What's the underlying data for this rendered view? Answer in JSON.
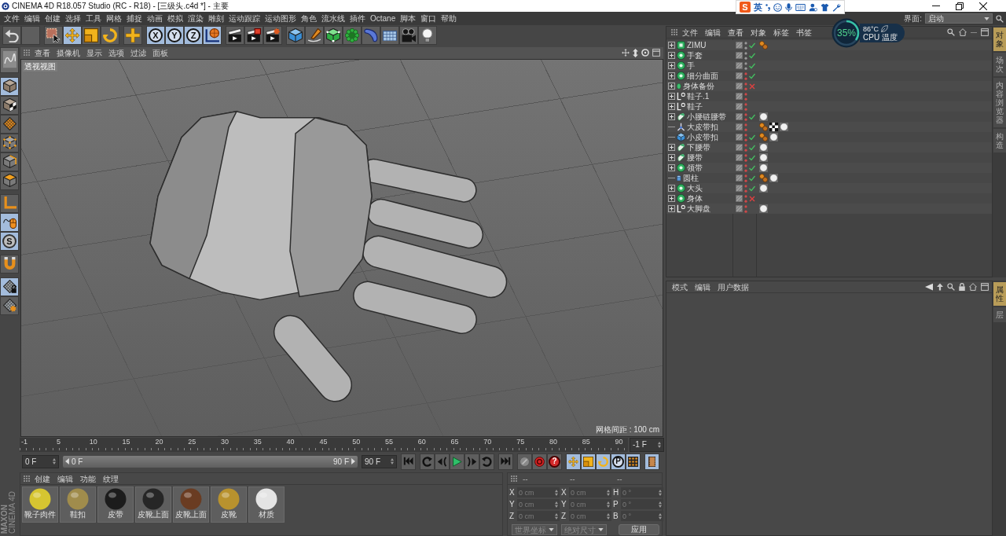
{
  "window": {
    "title": "CINEMA 4D R18.057 Studio (RC - R18) - [三级头.c4d *] - 主要"
  },
  "ime_bar": {
    "logo": "S",
    "mode": "英"
  },
  "cpu_widget": {
    "usage": "35%",
    "level": 0.35,
    "temperature": "86°C",
    "label": "CPU 温度"
  },
  "menu_bar": {
    "items": [
      "文件",
      "编辑",
      "创建",
      "选择",
      "工具",
      "网格",
      "捕捉",
      "动画",
      "模拟",
      "渲染",
      "雕刻",
      "运动跟踪",
      "运动图形",
      "角色",
      "流水线",
      "插件",
      "Octane",
      "脚本",
      "窗口",
      "帮助"
    ],
    "layout_label": "界面:",
    "layout_value": "启动"
  },
  "toolbar": {
    "groups": [
      [
        {
          "kind": "undo",
          "active": false
        },
        {
          "kind": "blank",
          "active": false
        }
      ],
      [
        {
          "kind": "select",
          "active": false
        },
        {
          "kind": "move",
          "active": true
        },
        {
          "kind": "scale",
          "active": false
        },
        {
          "kind": "rotate",
          "active": false
        }
      ],
      [
        {
          "kind": "add",
          "active": false
        }
      ],
      [
        {
          "kind": "axis",
          "label": "X",
          "active": true
        },
        {
          "kind": "axis",
          "label": "Y",
          "active": true
        },
        {
          "kind": "axis",
          "label": "Z",
          "active": true
        },
        {
          "kind": "world",
          "active": true
        }
      ],
      [
        {
          "kind": "render_view",
          "active": false
        },
        {
          "kind": "render_picture",
          "active": false
        },
        {
          "kind": "render_settings",
          "active": false
        }
      ],
      [
        {
          "kind": "cube",
          "active": false
        },
        {
          "kind": "pen",
          "active": false
        },
        {
          "kind": "subdivision",
          "active": false
        },
        {
          "kind": "array",
          "active": false
        },
        {
          "kind": "deformer",
          "active": false
        },
        {
          "kind": "floor",
          "active": false
        },
        {
          "kind": "camera",
          "active": false
        },
        {
          "kind": "light",
          "active": false
        }
      ]
    ]
  },
  "left_toolbar": {
    "groups": [
      [
        {
          "kind": "sculpt",
          "active": false
        }
      ],
      [
        {
          "kind": "model",
          "active": true
        },
        {
          "kind": "texture",
          "active": false
        },
        {
          "kind": "uv_grid",
          "active": false
        },
        {
          "kind": "points",
          "active": false
        },
        {
          "kind": "edges",
          "active": false
        },
        {
          "kind": "polygons",
          "active": false
        }
      ],
      [
        {
          "kind": "axis_mode",
          "active": false
        },
        {
          "kind": "tweak",
          "active": true
        },
        {
          "kind": "snap",
          "label": "S",
          "active": true
        }
      ],
      [
        {
          "kind": "magnet",
          "active": false
        }
      ],
      [
        {
          "kind": "workplane_lock",
          "active": true
        },
        {
          "kind": "workplane",
          "active": false
        }
      ]
    ]
  },
  "viewport": {
    "menu": [
      "查看",
      "摄像机",
      "显示",
      "选项",
      "过滤",
      "面板"
    ],
    "view_name": "透视视图",
    "grid_spacing": "网格间距 : 100 cm"
  },
  "timeline": {
    "ticks": [
      "-1",
      "5",
      "10",
      "15",
      "20",
      "25",
      "30",
      "35",
      "40",
      "45",
      "50",
      "55",
      "60",
      "65",
      "70",
      "75",
      "80",
      "85",
      "90"
    ],
    "current_frame": "-1 F"
  },
  "playback": {
    "start_field": "0 F",
    "range": {
      "start": "0 F",
      "end": "90 F"
    },
    "end_field": "90 F",
    "groups": [
      [
        {
          "kind": "go_start",
          "active": false
        }
      ],
      [
        {
          "kind": "prev_key",
          "active": false
        },
        {
          "kind": "prev_frame",
          "active": false
        },
        {
          "kind": "play",
          "active": false
        },
        {
          "kind": "next_frame",
          "active": false
        },
        {
          "kind": "next_key",
          "active": false
        }
      ],
      [
        {
          "kind": "go_end",
          "active": false
        }
      ],
      [
        {
          "kind": "record",
          "active": false
        },
        {
          "kind": "auto_key",
          "active": false
        },
        {
          "kind": "key_selection",
          "label": "?",
          "active": false
        }
      ],
      [
        {
          "kind": "key_move",
          "active": true
        },
        {
          "kind": "key_scale",
          "active": true
        },
        {
          "kind": "key_rotate",
          "active": true
        },
        {
          "kind": "key_param",
          "label": "P",
          "active": true
        },
        {
          "kind": "key_points",
          "active": true
        }
      ],
      [
        {
          "kind": "timeline_window",
          "active": true
        }
      ]
    ]
  },
  "logo": {
    "brand": "MAXON",
    "product": "CINEMA 4D"
  },
  "material_manager": {
    "menu": [
      "创建",
      "编辑",
      "功能",
      "纹理"
    ],
    "materials": [
      {
        "name": "靴子肉件",
        "color": "#d6c531"
      },
      {
        "name": "鞋扣",
        "color": "#a08c4c"
      },
      {
        "name": "皮带",
        "color": "#1c1c1c"
      },
      {
        "name": "皮靴上面",
        "color": "#262626"
      },
      {
        "name": "皮靴上面",
        "color": "#6a3c22"
      },
      {
        "name": "皮靴",
        "color": "#b8922e"
      },
      {
        "name": "材质",
        "color": "#e4e4e4"
      }
    ]
  },
  "coordinates": {
    "headers": [
      "--",
      "--",
      "--"
    ],
    "disabled": true,
    "rows": [
      {
        "axis": "X",
        "position": "0 cm",
        "size_axis": "X",
        "size": "0 cm",
        "rotation_axis": "H",
        "rotation": "0 °"
      },
      {
        "axis": "Y",
        "position": "0 cm",
        "size_axis": "Y",
        "size": "0 cm",
        "rotation_axis": "P",
        "rotation": "0 °"
      },
      {
        "axis": "Z",
        "position": "0 cm",
        "size_axis": "Z",
        "size": "0 cm",
        "rotation_axis": "B",
        "rotation": "0 °"
      }
    ],
    "coord_mode": "世界坐标",
    "size_mode": "绝对尺寸",
    "apply": "应用"
  },
  "object_manager": {
    "menu": [
      "文件",
      "编辑",
      "查看",
      "对象",
      "标签",
      "书签"
    ],
    "objects": [
      {
        "name": "ZIMU",
        "kind": "extrude",
        "expandable": true,
        "hidden": false,
        "toggle": {
          "enabled": true
        },
        "tags": [
          {
            "kind": "phong"
          }
        ]
      },
      {
        "name": "手套",
        "kind": "subdivision",
        "expandable": true,
        "hidden": false,
        "toggle": {
          "enabled": true
        }
      },
      {
        "name": "手",
        "kind": "subdivision",
        "expandable": true,
        "hidden": false,
        "toggle": {
          "enabled": true
        }
      },
      {
        "name": "细分曲面",
        "kind": "subdivision",
        "expandable": true,
        "hidden": true,
        "toggle": {
          "enabled": true
        }
      },
      {
        "name": "身体备份",
        "kind": "polygon",
        "expandable": true,
        "hidden": true,
        "toggle": {
          "enabled": false
        }
      },
      {
        "name": "鞋子.1",
        "kind": "null",
        "expandable": true,
        "hidden": true
      },
      {
        "name": "鞋子",
        "kind": "null",
        "expandable": true,
        "hidden": true
      },
      {
        "name": "小腰链腰带",
        "kind": "sweep",
        "expandable": true,
        "hidden": true,
        "toggle": {
          "enabled": true
        },
        "tags": [
          {
            "kind": "material"
          }
        ]
      },
      {
        "name": "大皮带扣",
        "kind": "connector",
        "expandable": false,
        "hidden": true,
        "tags": [
          {
            "kind": "phong"
          },
          {
            "kind": "checker"
          },
          {
            "kind": "material"
          }
        ]
      },
      {
        "name": "小皮带扣",
        "kind": "cube",
        "expandable": false,
        "hidden": true,
        "toggle": {
          "enabled": true
        },
        "tags": [
          {
            "kind": "phong"
          },
          {
            "kind": "material"
          }
        ]
      },
      {
        "name": "下腰带",
        "kind": "sweep",
        "expandable": true,
        "hidden": true,
        "toggle": {
          "enabled": true
        },
        "tags": [
          {
            "kind": "material"
          }
        ]
      },
      {
        "name": "腰带",
        "kind": "sweep",
        "expandable": true,
        "hidden": true,
        "toggle": {
          "enabled": true
        },
        "tags": [
          {
            "kind": "material"
          }
        ]
      },
      {
        "name": "领带",
        "kind": "subdivision",
        "expandable": true,
        "hidden": true,
        "toggle": {
          "enabled": true
        },
        "tags": [
          {
            "kind": "material"
          }
        ]
      },
      {
        "name": "圆柱",
        "kind": "cylinder",
        "expandable": false,
        "hidden": true,
        "toggle": {
          "enabled": true
        },
        "tags": [
          {
            "kind": "phong"
          },
          {
            "kind": "material"
          }
        ]
      },
      {
        "name": "大头",
        "kind": "subdivision",
        "expandable": true,
        "hidden": true,
        "toggle": {
          "enabled": true
        },
        "tags": [
          {
            "kind": "material"
          }
        ]
      },
      {
        "name": "身体",
        "kind": "subdivision",
        "expandable": true,
        "hidden": true,
        "toggle": {
          "enabled": false
        }
      },
      {
        "name": "大脚盘",
        "kind": "null",
        "expandable": true,
        "hidden": true,
        "tags": [
          {
            "kind": "material"
          }
        ]
      }
    ],
    "side_tabs": [
      {
        "label": "对象",
        "selected": true
      },
      {
        "label": "场次",
        "selected": false
      },
      {
        "label": "内容浏览器",
        "selected": false
      },
      {
        "label": "构造",
        "selected": false
      }
    ]
  },
  "attribute_manager": {
    "menu": [
      "模式",
      "编辑",
      "用户数据"
    ],
    "side_tabs": [
      {
        "label": "属性",
        "selected": true
      },
      {
        "label": "层",
        "selected": false
      }
    ]
  }
}
